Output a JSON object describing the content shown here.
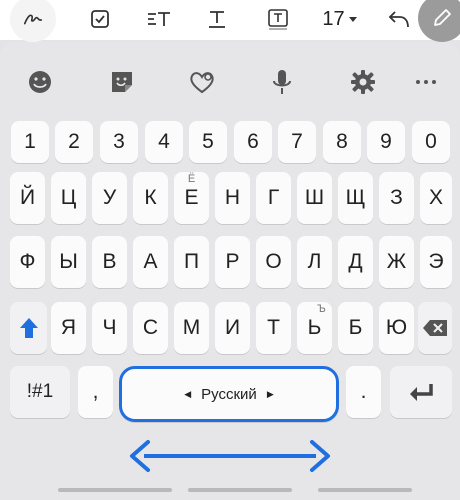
{
  "toolbar": {
    "icons": [
      "handwriting-icon",
      "checkbox-icon",
      "text-style-icon",
      "text-underline-icon",
      "text-box-icon",
      "undo-icon",
      "pen-icon"
    ],
    "font_size": "17"
  },
  "suggestions": {
    "icons": [
      "emoji-icon",
      "sticker-icon",
      "heart-emoji-icon",
      "microphone-icon",
      "settings-icon",
      "more-icon"
    ]
  },
  "keyboard": {
    "numbers": [
      "1",
      "2",
      "3",
      "4",
      "5",
      "6",
      "7",
      "8",
      "9",
      "0"
    ],
    "row1": [
      "Й",
      "Ц",
      "У",
      "К",
      "Е",
      "Н",
      "Г",
      "Ш",
      "Щ",
      "З",
      "Х"
    ],
    "row1_sub": {
      "e_alt": "Ё"
    },
    "row2": [
      "Ф",
      "Ы",
      "В",
      "А",
      "П",
      "Р",
      "О",
      "Л",
      "Д",
      "Ж",
      "Э"
    ],
    "row3": [
      "Я",
      "Ч",
      "С",
      "М",
      "И",
      "Т",
      "Ь",
      "Б",
      "Ю"
    ],
    "row3_sub": {
      "soft_alt": "Ъ"
    },
    "symbols_label": "!#1",
    "comma": ",",
    "space_label": "Русский",
    "period": "."
  },
  "colors": {
    "accent": "#1f6fe0",
    "key_bg": "#fbfbfb",
    "panel_bg": "#e6e6e9"
  }
}
